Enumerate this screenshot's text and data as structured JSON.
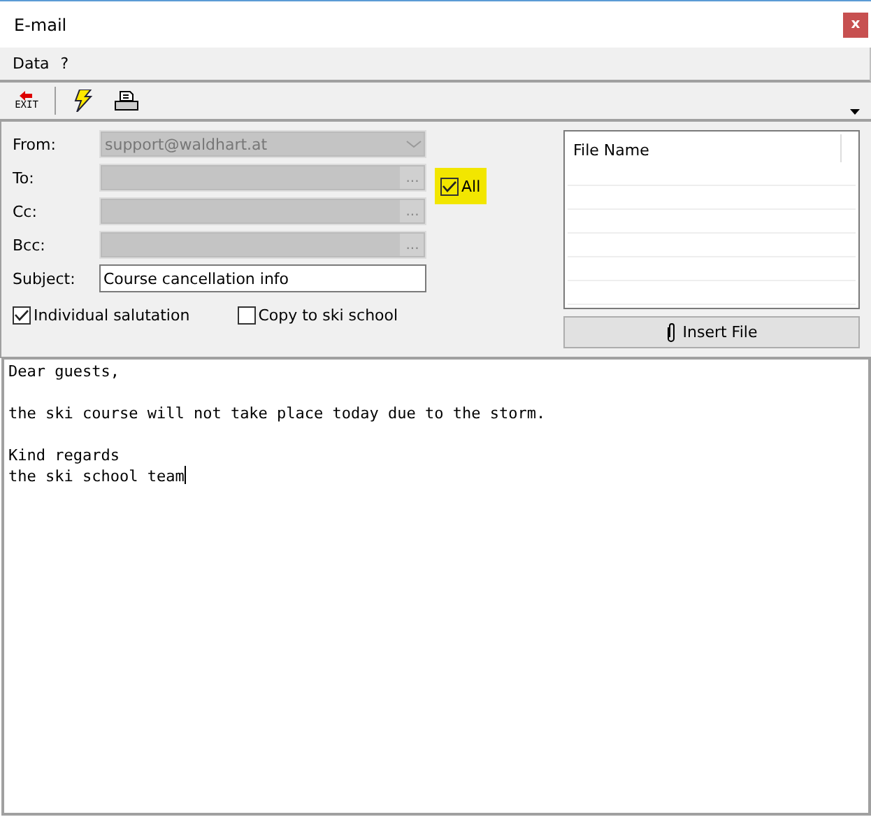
{
  "window": {
    "title": "E-mail",
    "close": "x"
  },
  "menu": [
    "Data",
    "?"
  ],
  "toolbar": [
    {
      "kind": "exit",
      "label": "EXIT"
    },
    {
      "kind": "lightning"
    },
    {
      "kind": "print"
    }
  ],
  "fields": [
    {
      "kind": "dropdown",
      "label": "From:",
      "value": "support@waldhart.at",
      "disabled": true
    },
    {
      "kind": "picker",
      "label": "To:",
      "button": "...",
      "disabled": true
    },
    {
      "kind": "picker",
      "label": "Cc:",
      "button": "...",
      "disabled": true
    },
    {
      "kind": "picker",
      "label": "Bcc:",
      "button": "...",
      "disabled": true
    },
    {
      "kind": "text",
      "label": "Subject:",
      "value": "Course cancellation info",
      "disabled": false
    }
  ],
  "all_checkbox": {
    "label": "All",
    "checked": true,
    "highlighted": true
  },
  "options": [
    {
      "label": "Individual salutation",
      "checked": true
    },
    {
      "label": "Copy to ski school",
      "checked": false
    }
  ],
  "attachments": {
    "columns": [
      "File Name"
    ],
    "button": "Insert File"
  },
  "body": "Dear guests,\n\nthe ski course will not take place today due to the storm.\n\nKind regards\nthe ski school team"
}
